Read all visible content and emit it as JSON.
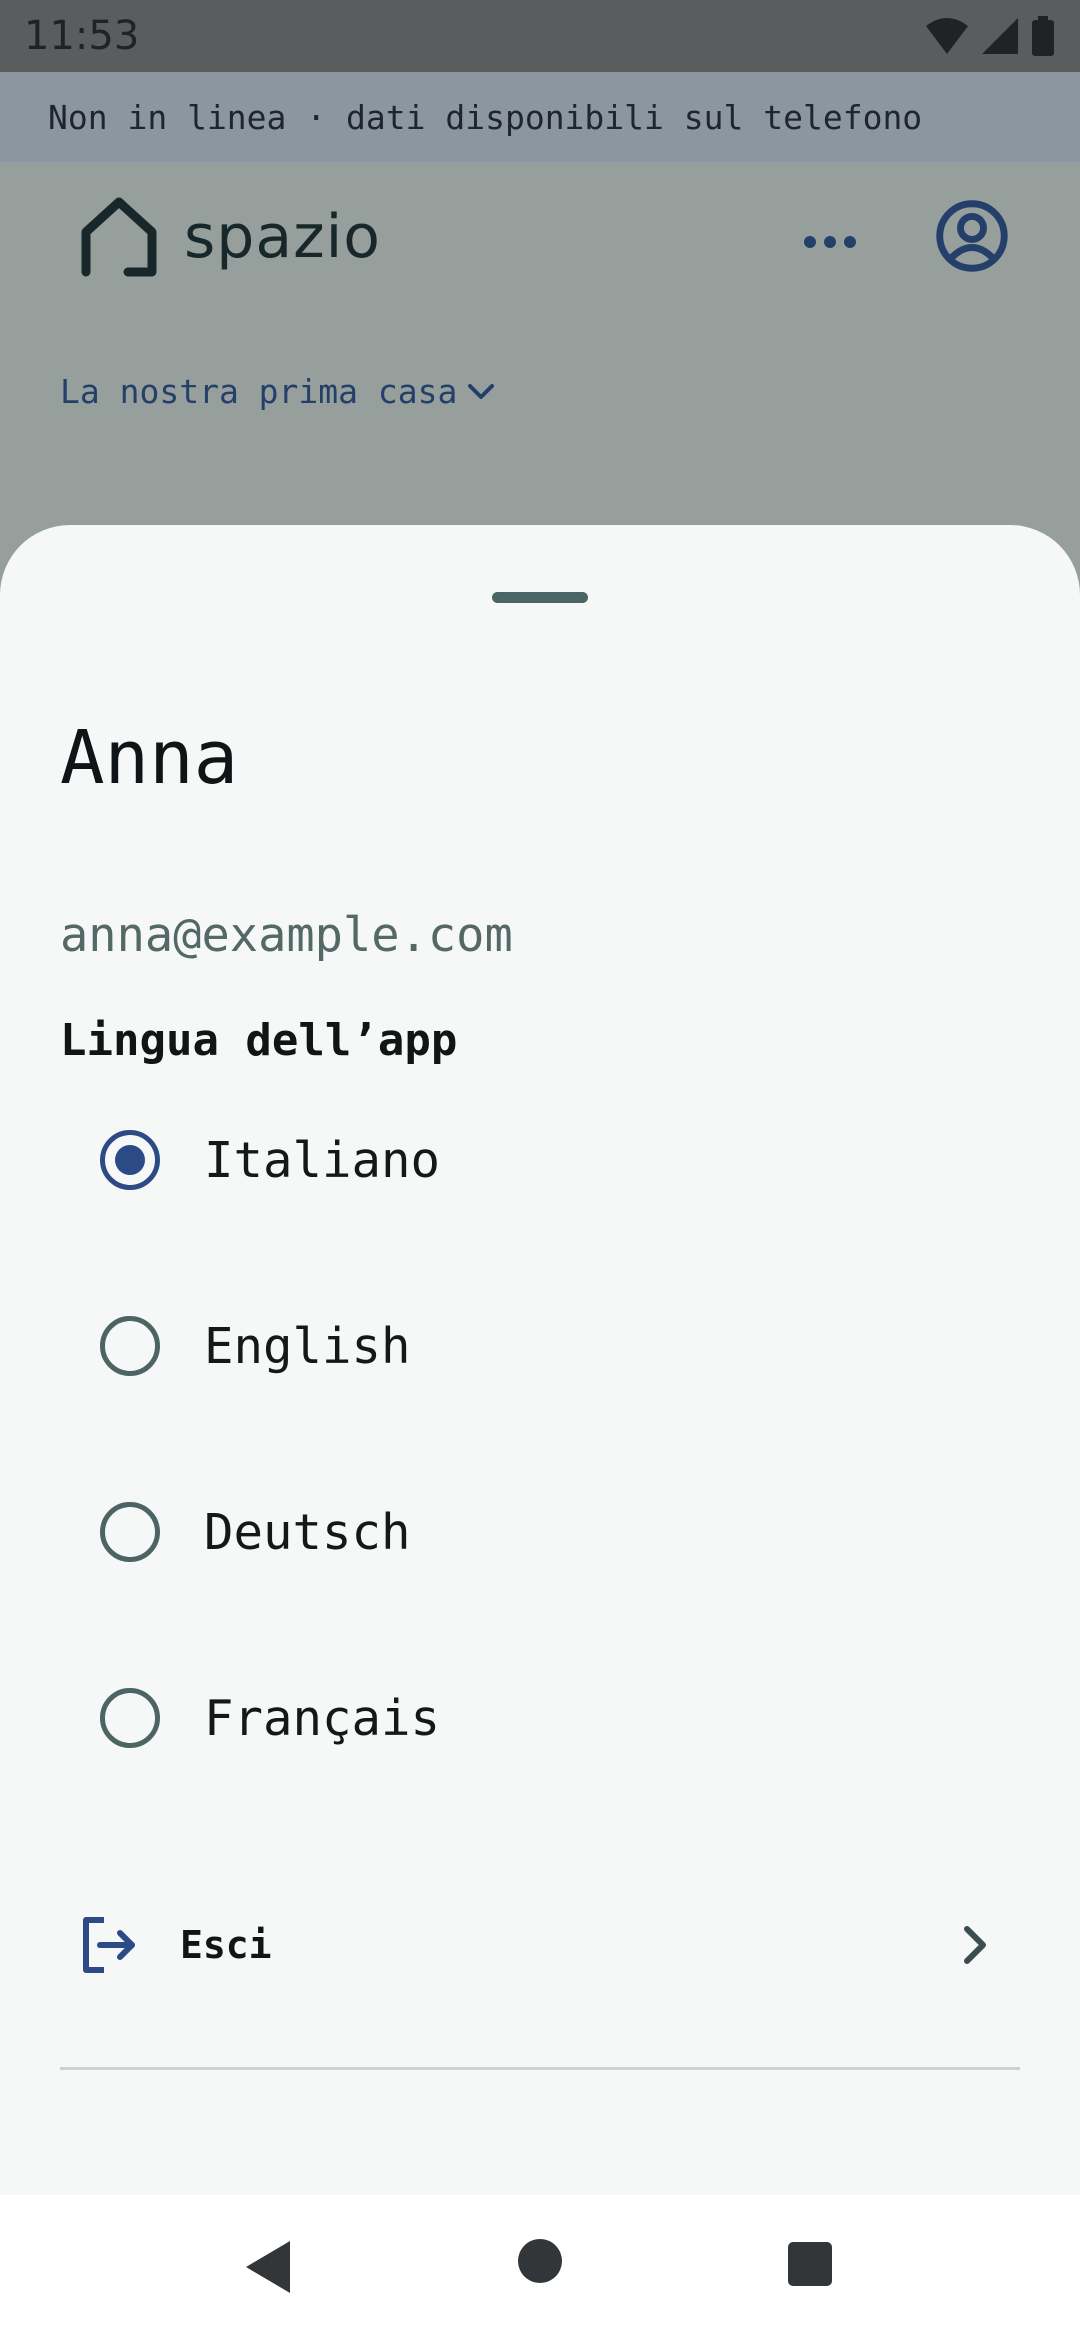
{
  "status_bar": {
    "time": "11:53",
    "icons": [
      "wifi-icon",
      "signal-icon",
      "battery-icon"
    ]
  },
  "offline_banner": {
    "text": "Non in linea · dati disponibili sul telefono"
  },
  "header": {
    "logo_text": "spazio",
    "home_selector": "La nostra prima casa"
  },
  "sheet": {
    "user_name": "Anna",
    "user_email": "anna@example.com",
    "language_heading": "Lingua dell’app",
    "languages": [
      {
        "label": "Italiano",
        "selected": true
      },
      {
        "label": "English",
        "selected": false
      },
      {
        "label": "Deutsch",
        "selected": false
      },
      {
        "label": "Français",
        "selected": false
      }
    ],
    "logout_label": "Esci"
  },
  "colors": {
    "accent": "#2c4b86",
    "sheet_bg": "#f5f8f7",
    "scrim": "#969f9c",
    "banner": "#8c96a0"
  }
}
